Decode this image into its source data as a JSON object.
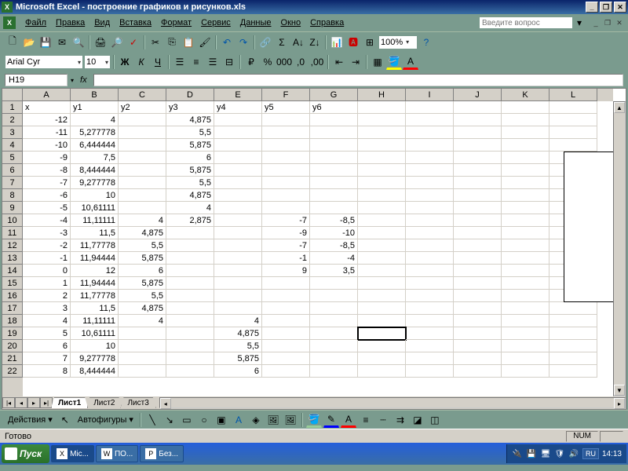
{
  "title": "Microsoft Excel - построение графиков и рисунков.xls",
  "menus": [
    "Файл",
    "Правка",
    "Вид",
    "Вставка",
    "Формат",
    "Сервис",
    "Данные",
    "Окно",
    "Справка"
  ],
  "help_placeholder": "Введите вопрос",
  "font_name": "Arial Cyr",
  "font_size": "10",
  "zoom": "100%",
  "namebox": "H19",
  "formula": "",
  "columns": [
    "A",
    "B",
    "C",
    "D",
    "E",
    "F",
    "G",
    "H",
    "I",
    "J",
    "K",
    "L"
  ],
  "row_start": 1,
  "row_end": 22,
  "selected_cell": {
    "row": 19,
    "col": "H"
  },
  "cells": {
    "1": {
      "A": "x",
      "B": "y1",
      "C": "y2",
      "D": "y3",
      "E": "y4",
      "F": "y5",
      "G": "y6"
    },
    "2": {
      "A": "-12",
      "B": "4",
      "D": "4,875"
    },
    "3": {
      "A": "-11",
      "B": "5,277778",
      "D": "5,5"
    },
    "4": {
      "A": "-10",
      "B": "6,444444",
      "D": "5,875"
    },
    "5": {
      "A": "-9",
      "B": "7,5",
      "D": "6"
    },
    "6": {
      "A": "-8",
      "B": "8,444444",
      "D": "5,875"
    },
    "7": {
      "A": "-7",
      "B": "9,277778",
      "D": "5,5"
    },
    "8": {
      "A": "-6",
      "B": "10",
      "D": "4,875"
    },
    "9": {
      "A": "-5",
      "B": "10,61111",
      "D": "4"
    },
    "10": {
      "A": "-4",
      "B": "11,11111",
      "C": "4",
      "D": "2,875",
      "F": "-7",
      "G": "-8,5"
    },
    "11": {
      "A": "-3",
      "B": "11,5",
      "C": "4,875",
      "F": "-9",
      "G": "-10"
    },
    "12": {
      "A": "-2",
      "B": "11,77778",
      "C": "5,5",
      "F": "-7",
      "G": "-8,5"
    },
    "13": {
      "A": "-1",
      "B": "11,94444",
      "C": "5,875",
      "F": "-1",
      "G": "-4"
    },
    "14": {
      "A": "0",
      "B": "12",
      "C": "6",
      "F": "9",
      "G": "3,5"
    },
    "15": {
      "A": "1",
      "B": "11,94444",
      "C": "5,875"
    },
    "16": {
      "A": "2",
      "B": "11,77778",
      "C": "5,5"
    },
    "17": {
      "A": "3",
      "B": "11,5",
      "C": "4,875"
    },
    "18": {
      "A": "4",
      "B": "11,11111",
      "C": "4",
      "E": "4"
    },
    "19": {
      "A": "5",
      "B": "10,61111",
      "E": "4,875"
    },
    "20": {
      "A": "6",
      "B": "10",
      "E": "5,5"
    },
    "21": {
      "A": "7",
      "B": "9,277778",
      "E": "5,875"
    },
    "22": {
      "A": "8",
      "B": "8,444444",
      "E": "6"
    }
  },
  "sheets": [
    "Лист1",
    "Лист2",
    "Лист3"
  ],
  "active_sheet": 0,
  "drawbar": {
    "actions": "Действия",
    "autoshapes": "Автофигуры"
  },
  "status": "Готово",
  "status_num": "NUM",
  "taskbar": {
    "start": "Пуск",
    "tasks": [
      {
        "icon": "X",
        "label": "Mic..."
      },
      {
        "icon": "W",
        "label": "ПО..."
      },
      {
        "icon": "P",
        "label": "Без..."
      }
    ],
    "lang": "RU",
    "time": "14:13"
  }
}
